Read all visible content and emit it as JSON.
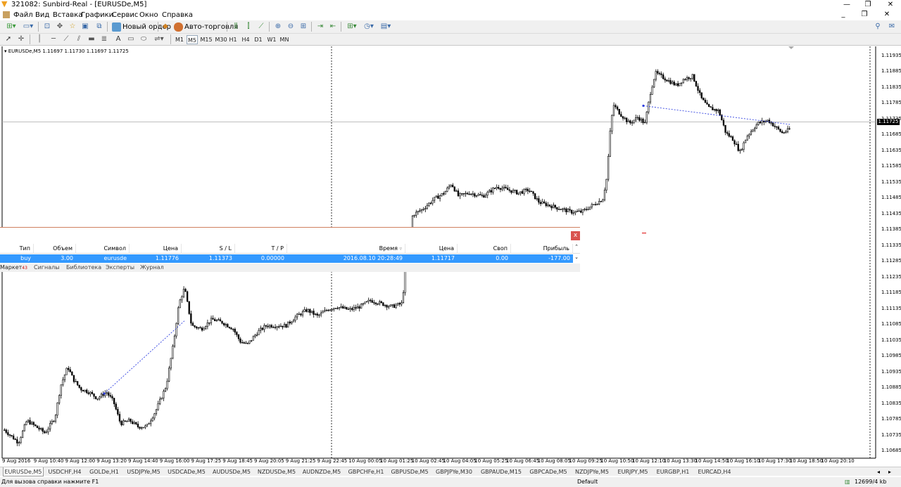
{
  "window": {
    "title": "321082: Sunbird-Real - [EURUSDe,M5]"
  },
  "menu": [
    "Файл",
    "Вид",
    "Вставка",
    "Графики",
    "Сервис",
    "Окно",
    "Справка"
  ],
  "toolbar": {
    "new_order": "Новый ордер",
    "auto_trading": "Авто-торговля",
    "line_tools": [
      "A"
    ],
    "timeframes": [
      "M1",
      "M5",
      "M15",
      "M30",
      "H1",
      "H4",
      "D1",
      "W1",
      "MN"
    ],
    "active_timeframe": "M5"
  },
  "chart": {
    "label": "EURUSDe,M5  1.11697 1.11730 1.11697 1.11725",
    "current_price": "1.11725",
    "price_ticks": [
      "1.11935",
      "1.11885",
      "1.11835",
      "1.11785",
      "1.11735",
      "1.11685",
      "1.11635",
      "1.11585",
      "1.11535",
      "1.11485",
      "1.11435",
      "1.11385",
      "1.11335",
      "1.11285",
      "1.11235",
      "1.11185",
      "1.11135",
      "1.11085",
      "1.11035",
      "1.10985",
      "1.10935",
      "1.10885",
      "1.10835",
      "1.10785",
      "1.10735",
      "1.10685"
    ],
    "time_ticks": [
      "9 Aug 2016",
      "9 Aug 10:40",
      "9 Aug 12:00",
      "9 Aug 13:20",
      "9 Aug 14:40",
      "9 Aug 16:00",
      "9 Aug 17:25",
      "9 Aug 18:45",
      "9 Aug 20:05",
      "9 Aug 21:25",
      "9 Aug 22:45",
      "10 Aug 00:05",
      "10 Aug 01:25",
      "10 Aug 02:45",
      "10 Aug 04:05",
      "10 Aug 05:25",
      "10 Aug 06:45",
      "10 Aug 08:05",
      "10 Aug 09:25",
      "10 Aug 10:50",
      "10 Aug 12:10",
      "10 Aug 13:30",
      "10 Aug 14:50",
      "10 Aug 16:10",
      "10 Aug 17:30",
      "10 Aug 18:50",
      "10 Aug 20:10"
    ]
  },
  "chart_data": {
    "type": "candlestick",
    "symbol": "EURUSDe",
    "timeframe": "M5",
    "last_ohlc": {
      "open": 1.11697,
      "high": 1.1173,
      "low": 1.11697,
      "close": 1.11725
    },
    "y_range": [
      1.10685,
      1.11955
    ],
    "close_path": [
      [
        0,
        1.1075
      ],
      [
        10,
        1.1073
      ],
      [
        20,
        1.1071
      ],
      [
        32,
        1.1078
      ],
      [
        45,
        1.1076
      ],
      [
        58,
        1.1074
      ],
      [
        72,
        1.1079
      ],
      [
        80,
        1.1089
      ],
      [
        90,
        1.1095
      ],
      [
        98,
        1.1091
      ],
      [
        108,
        1.1088
      ],
      [
        120,
        1.1087
      ],
      [
        132,
        1.1085
      ],
      [
        145,
        1.1087
      ],
      [
        155,
        1.1084
      ],
      [
        165,
        1.1077
      ],
      [
        178,
        1.1078
      ],
      [
        190,
        1.1076
      ],
      [
        202,
        1.1076
      ],
      [
        215,
        1.1081
      ],
      [
        230,
        1.1089
      ],
      [
        240,
        1.1102
      ],
      [
        248,
        1.1115
      ],
      [
        256,
        1.112
      ],
      [
        266,
        1.1108
      ],
      [
        280,
        1.1107
      ],
      [
        295,
        1.111
      ],
      [
        310,
        1.1109
      ],
      [
        325,
        1.1107
      ],
      [
        335,
        1.1103
      ],
      [
        345,
        1.1102
      ],
      [
        360,
        1.1106
      ],
      [
        372,
        1.1108
      ],
      [
        385,
        1.1108
      ],
      [
        400,
        1.1108
      ],
      [
        415,
        1.1111
      ],
      [
        430,
        1.1113
      ],
      [
        445,
        1.1111
      ],
      [
        458,
        1.1113
      ],
      [
        472,
        1.1114
      ],
      [
        490,
        1.1113
      ],
      [
        505,
        1.1114
      ],
      [
        520,
        1.1116
      ],
      [
        535,
        1.1115
      ],
      [
        550,
        1.1114
      ],
      [
        565,
        1.1115
      ],
      [
        570,
        1.1126
      ],
      [
        580,
        1.1143
      ],
      [
        595,
        1.1145
      ],
      [
        610,
        1.1148
      ],
      [
        625,
        1.115
      ],
      [
        635,
        1.1153
      ],
      [
        645,
        1.1149
      ],
      [
        660,
        1.115
      ],
      [
        680,
        1.1149
      ],
      [
        700,
        1.1152
      ],
      [
        715,
        1.1151
      ],
      [
        730,
        1.115
      ],
      [
        745,
        1.1151
      ],
      [
        760,
        1.1147
      ],
      [
        775,
        1.1146
      ],
      [
        790,
        1.1145
      ],
      [
        805,
        1.1144
      ],
      [
        820,
        1.1144
      ],
      [
        835,
        1.1146
      ],
      [
        850,
        1.1148
      ],
      [
        856,
        1.1155
      ],
      [
        860,
        1.1168
      ],
      [
        865,
        1.1178
      ],
      [
        875,
        1.1175
      ],
      [
        888,
        1.1172
      ],
      [
        900,
        1.1174
      ],
      [
        910,
        1.1172
      ],
      [
        918,
        1.1182
      ],
      [
        925,
        1.1188
      ],
      [
        940,
        1.1186
      ],
      [
        955,
        1.1184
      ],
      [
        965,
        1.1186
      ],
      [
        978,
        1.1187
      ],
      [
        990,
        1.118
      ],
      [
        1000,
        1.1177
      ],
      [
        1015,
        1.1176
      ],
      [
        1025,
        1.1169
      ],
      [
        1035,
        1.1167
      ],
      [
        1045,
        1.1163
      ],
      [
        1055,
        1.1168
      ],
      [
        1070,
        1.1172
      ],
      [
        1085,
        1.1173
      ],
      [
        1095,
        1.1171
      ],
      [
        1105,
        1.1169
      ],
      [
        1115,
        1.117
      ],
      [
        1122,
        1.11725
      ]
    ]
  },
  "terminal": {
    "close_label": "x",
    "columns": [
      "Тип",
      "Объем",
      "Символ",
      "Цена",
      "S / L",
      "T / P",
      "Время",
      "Цена",
      "Своп",
      "Прибыль"
    ],
    "rows": [
      {
        "type": "buy",
        "volume": "3.00",
        "symbol": "eurusde",
        "open_price": "1.11776",
        "sl": "1.11373",
        "tp": "0.00000",
        "time": "2016.08.10 20:28:49",
        "price": "1.11717",
        "swap": "0.00",
        "profit": "-177.00"
      }
    ],
    "tabs": [
      "Маркет",
      "Сигналы",
      "Библиотека",
      "Эксперты",
      "Журнал"
    ],
    "market_badge": "43"
  },
  "chart_tabs": [
    "EURUSDe,M5",
    "USDCHF,H4",
    "GOLDe,H1",
    "USDJPYe,M5",
    "USDCADe,M5",
    "AUDUSDe,M5",
    "NZDUSDe,M5",
    "AUDNZDe,M5",
    "GBPCHFe,H1",
    "GBPUSDe,M5",
    "GBPJPYe,M30",
    "GBPAUDe,M15",
    "GBPCADe,M5",
    "NZDJPYe,M5",
    "EURJPY,M5",
    "EURGBP,H1",
    "EURCAD,H4"
  ],
  "active_chart_tab": "EURUSDe,M5",
  "status": {
    "help": "Для вызова справки нажмите F1",
    "profile": "Default",
    "traffic": "12699/4 kb"
  }
}
